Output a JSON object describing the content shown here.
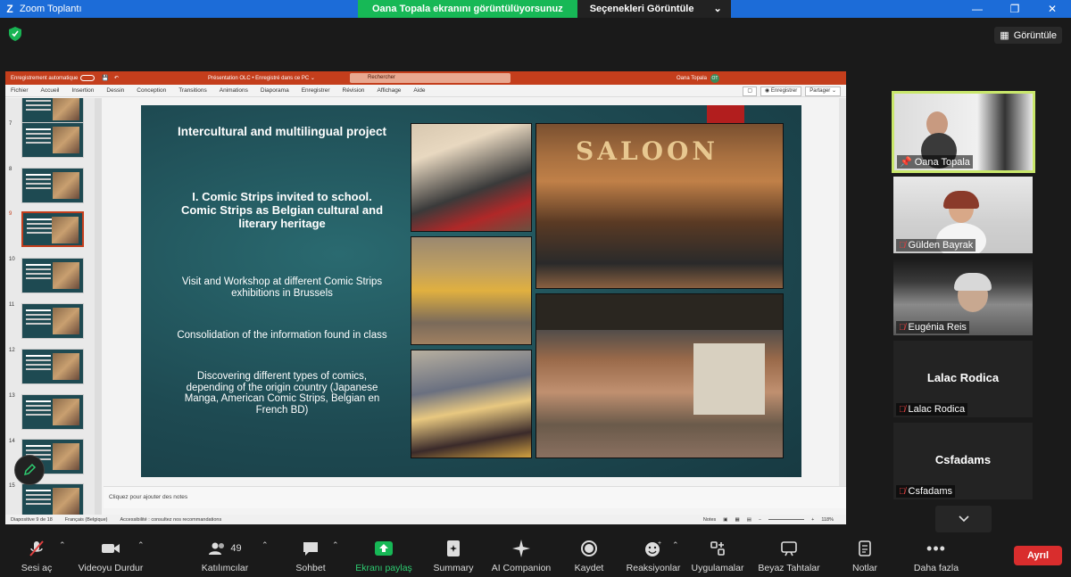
{
  "app": {
    "title": "Zoom Toplantı",
    "logo": "Z"
  },
  "share_banner": {
    "status": "Oana Topala ekranını görüntülüyorsunuz",
    "options": "Seçenekleri Görüntüle"
  },
  "view_button": "Görüntüle",
  "powerpoint": {
    "autosave": "Enregistrement automatique",
    "doc_title": "Présentation OLC • Enregistré dans ce PC ⌄",
    "search_placeholder": "Rechercher",
    "user": "Oana Topala",
    "user_initials": "OT",
    "menu": [
      "Fichier",
      "Accueil",
      "Insertion",
      "Dessin",
      "Conception",
      "Transitions",
      "Animations",
      "Diaporama",
      "Enregistrer",
      "Révision",
      "Affichage",
      "Aide"
    ],
    "record_btn": "◉ Enregistrer",
    "share_btn": "Partager ⌄",
    "thumb_numbers": [
      "7",
      "8",
      "9",
      "10",
      "11",
      "12",
      "13",
      "14",
      "15"
    ],
    "notes_placeholder": "Cliquez pour ajouter des notes",
    "status": {
      "slide": "Diapositive 9 de 18",
      "language": "Français (Belgique)",
      "accessibility": "Accessibilité : consultez nos recommandations",
      "notes": "Notes",
      "zoom": "118%"
    }
  },
  "slide": {
    "title": "Intercultural and multilingual project",
    "heading": "I. Comic Strips invited to school. Comic Strips as Belgian cultural and literary heritage",
    "bullet1": "Visit and Workshop at different Comic Strips exhibitions in Brussels",
    "bullet2": "Consolidation of the information found in class",
    "bullet3": "Discovering different types of comics, depending of the origin country (Japanese Manga, American Comic Strips, Belgian en French BD)",
    "saloon_sign": "SALOON"
  },
  "participants": [
    {
      "name": "Oana Topala",
      "type": "video"
    },
    {
      "name": "Gülden Bayrak",
      "type": "video"
    },
    {
      "name": "Eugénia Reis",
      "type": "video"
    },
    {
      "name": "Lalac Rodica",
      "type": "name",
      "display": "Lalac Rodica"
    },
    {
      "name": "Csfadams",
      "type": "name",
      "display": "Csfadams"
    }
  ],
  "toolbar": {
    "mute": "Sesi aç",
    "video": "Videoyu Durdur",
    "participants": "Katılımcılar",
    "participants_count": "49",
    "chat": "Sohbet",
    "share": "Ekranı paylaş",
    "summary": "Summary",
    "ai": "AI Companion",
    "record": "Kaydet",
    "reactions": "Reaksiyonlar",
    "apps": "Uygulamalar",
    "whiteboards": "Beyaz Tahtalar",
    "notes": "Notlar",
    "more": "Daha fazla",
    "leave": "Ayrıl"
  },
  "colors": {
    "zoom_blue": "#1c6cd8",
    "share_green": "#17b856",
    "ppt_red": "#c43e1c",
    "slide_teal": "#1e4a52",
    "speaker_border": "#c9e76b",
    "leave_red": "#d92d2d"
  }
}
